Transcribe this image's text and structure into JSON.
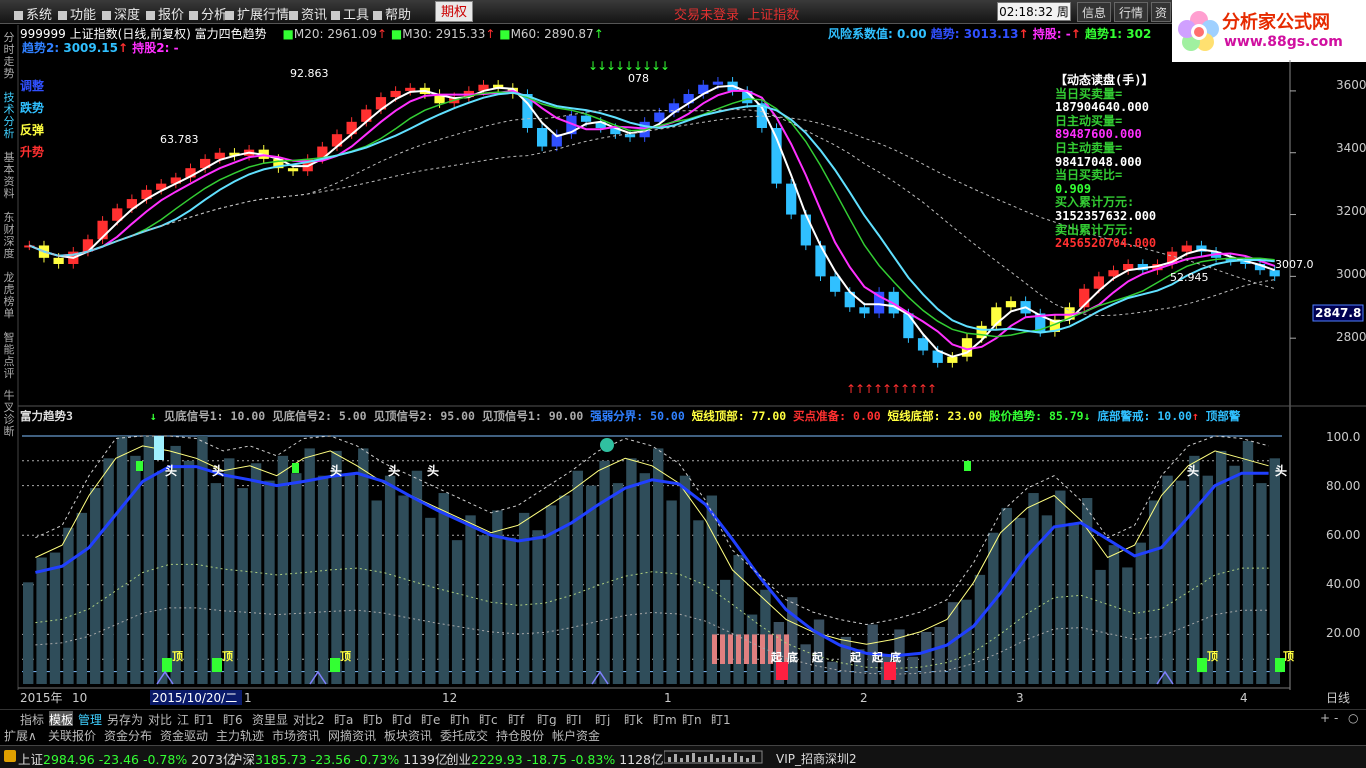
{
  "menu": {
    "items": [
      "系统",
      "功能",
      "深度",
      "报价",
      "分析",
      "扩展行情",
      "资讯",
      "工具",
      "帮助"
    ],
    "qiquan": "期权",
    "status_a": "交易未登录",
    "status_b": "上证指数",
    "time": "02:18:32",
    "day": "周日",
    "btn_info": "信息",
    "btn_quote": "行情",
    "btn_more": "资"
  },
  "logo": {
    "text": "分析家公式网",
    "url": "www.88gs.com"
  },
  "side_tabs": [
    "分时走势",
    "技术分析",
    "基本资料",
    "东财深度",
    "龙虎榜单",
    "智能点评",
    "牛叉诊断"
  ],
  "main_chart": {
    "code": "999999",
    "name": "上证指数(日线,前复权)",
    "formula": "富力四色趋势",
    "ma": [
      {
        "label": "M20:",
        "value": "2961.09",
        "color": "#ff3030"
      },
      {
        "label": "M30:",
        "value": "2915.33",
        "color": "#ff3030"
      },
      {
        "label": "M60:",
        "value": "2890.87",
        "color": "#33ff33"
      }
    ],
    "trend2_label": "趋势2:",
    "trend2_value": "3009.15",
    "hold2_label": "持股2:",
    "hold2_value": "-",
    "risk_label": "风险系数值:",
    "risk_value": "0.00",
    "trend_label": "趋势:",
    "trend_value": "3013.13",
    "hold_label": "持股:",
    "hold_value": "-",
    "trend1_label": "趋势1:",
    "trend1_value": "302",
    "legend": [
      {
        "text": "调整",
        "color": "#3050ff"
      },
      {
        "text": "跌势",
        "color": "#30c0ff"
      },
      {
        "text": "反弹",
        "color": "#ffff40"
      },
      {
        "text": "升势",
        "color": "#ff3030"
      }
    ],
    "annotations": [
      "92.863",
      "63.783",
      "078",
      "52.945",
      "3007.0"
    ],
    "price_tag": "2847.8",
    "y_ticks": [
      "3600",
      "3400",
      "3200",
      "3000",
      "2800"
    ]
  },
  "info_panel": {
    "title": "【动态读盘(手)】",
    "rows": [
      {
        "label": "当日买卖量=",
        "value": "187904640.000",
        "color": "#ffffff"
      },
      {
        "label": "日主动买量=",
        "value": "89487600.000",
        "color": "#ff30ff"
      },
      {
        "label": "日主动卖量=",
        "value": "98417048.000",
        "color": "#ffffff"
      },
      {
        "label": "当日买卖比=",
        "value": "0.909",
        "color": "#33ff33"
      },
      {
        "label": "买入累计万元:",
        "value": "3152357632.000",
        "color": "#ffffff"
      },
      {
        "label": "卖出累计万元:",
        "value": "2456520704.000",
        "color": "#ff3030"
      }
    ]
  },
  "sub_chart": {
    "name": "富力趋势3",
    "signals": [
      {
        "label": "见底信号1:",
        "value": "10.00"
      },
      {
        "label": "见底信号2:",
        "value": "5.00"
      },
      {
        "label": "见顶信号2:",
        "value": "95.00"
      },
      {
        "label": "见顶信号1:",
        "value": "90.00"
      }
    ],
    "indicators": [
      {
        "label": "强弱分界:",
        "value": "50.00",
        "color": "#3080ff"
      },
      {
        "label": "短线顶部:",
        "value": "77.00",
        "color": "#ffff40"
      },
      {
        "label": "买点准备:",
        "value": "0.00",
        "color": "#ff3030"
      },
      {
        "label": "短线底部:",
        "value": "23.00",
        "color": "#ffff40"
      },
      {
        "label": "股价趋势:",
        "value": "85.79",
        "color": "#33ff33",
        "arrow": "↓"
      },
      {
        "label": "底部警戒:",
        "value": "10.00",
        "color": "#30c0ff",
        "arrow": "↑"
      },
      {
        "label": "顶部警",
        "value": "",
        "color": "#30c0ff"
      }
    ],
    "y_ticks": [
      "100.0",
      "80.00",
      "60.00",
      "40.00",
      "20.00"
    ],
    "marks": {
      "head": "头",
      "top": "顶",
      "rise": "起",
      "bottom": "底"
    }
  },
  "x_axis": {
    "labels": [
      "2015年",
      "10",
      "2015/10/20/二",
      "1",
      "12",
      "1",
      "2",
      "3",
      "4"
    ],
    "period": "日线"
  },
  "toolbar1": [
    "指标",
    "模板",
    "管理",
    "另存为",
    "对比",
    "江",
    "盯1",
    "盯6",
    "资里显",
    "对比2",
    "盯a",
    "盯b",
    "盯d",
    "盯e",
    "盯h",
    "盯c",
    "盯f",
    "盯g",
    "盯I",
    "盯j",
    "盯k",
    "盯m",
    "盯n",
    "盯1"
  ],
  "toolbar1_right": [
    "+",
    "-",
    "○"
  ],
  "toolbar2": [
    "扩展∧",
    "关联报价",
    "资金分布",
    "资金驱动",
    "主力轨迹",
    "市场资讯",
    "网摘资讯",
    "板块资讯",
    "委托成交",
    "持仓股份",
    "帐户资金"
  ],
  "bottom": {
    "items": [
      {
        "name": "上证",
        "price": "2984.96",
        "chg": "-23.46",
        "pct": "-0.78%",
        "amt": "2073亿"
      },
      {
        "name": "沪深",
        "price": "3185.73",
        "chg": "-23.56",
        "pct": "-0.73%",
        "amt": "1139亿"
      },
      {
        "name": "创业",
        "price": "2229.93",
        "chg": "-18.75",
        "pct": "-0.83%",
        "amt": "1128亿"
      }
    ],
    "vip": "VIP_招商深圳2"
  },
  "chart_data": {
    "type": "candlestick",
    "title": "上证指数(日线,前复权)",
    "ylim": [
      2600,
      3700
    ],
    "closes": [
      3100,
      3060,
      3040,
      3080,
      3120,
      3180,
      3220,
      3250,
      3280,
      3300,
      3320,
      3350,
      3380,
      3400,
      3390,
      3410,
      3380,
      3350,
      3340,
      3380,
      3420,
      3460,
      3500,
      3540,
      3580,
      3600,
      3610,
      3590,
      3560,
      3580,
      3600,
      3620,
      3610,
      3590,
      3480,
      3420,
      3460,
      3520,
      3500,
      3480,
      3460,
      3450,
      3500,
      3530,
      3560,
      3590,
      3620,
      3630,
      3600,
      3560,
      3480,
      3300,
      3200,
      3100,
      3000,
      2950,
      2900,
      2880,
      2950,
      2880,
      2800,
      2760,
      2720,
      2740,
      2800,
      2840,
      2900,
      2920,
      2880,
      2820,
      2860,
      2900,
      2960,
      3000,
      3020,
      3040,
      3020,
      3040,
      3080,
      3100,
      3080,
      3060,
      3050,
      3040,
      3020,
      3000
    ],
    "sub_values": [
      45,
      50,
      70,
      85,
      90,
      88,
      85,
      80,
      82,
      78,
      85,
      88,
      82,
      75,
      70,
      65,
      60,
      55,
      58,
      65,
      72,
      80,
      85,
      82,
      75,
      60,
      40,
      30,
      20,
      15,
      12,
      10,
      12,
      15,
      20,
      35,
      55,
      65,
      70,
      60,
      45,
      50,
      70,
      82,
      88,
      85,
      82
    ]
  }
}
